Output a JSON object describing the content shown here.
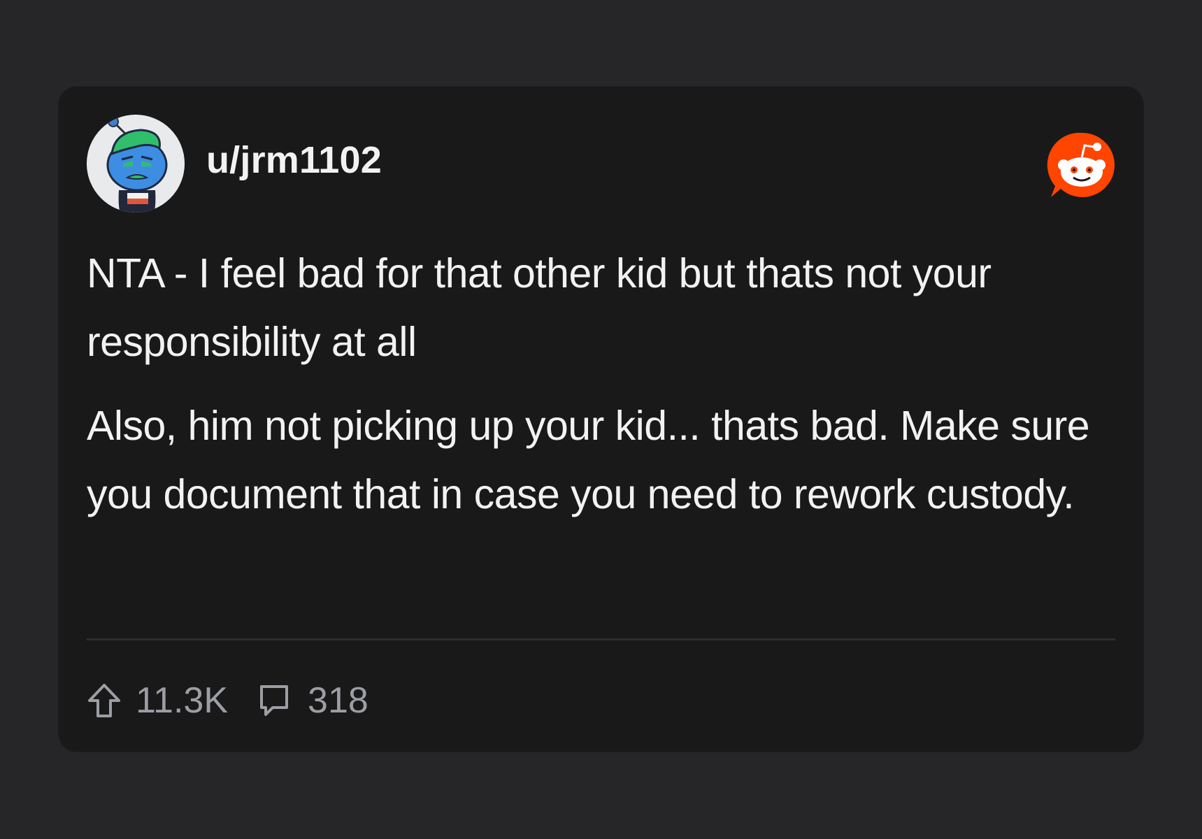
{
  "post": {
    "username": "u/jrm1102",
    "paragraphs": [
      "NTA - I feel bad for that other kid but thats not your responsibility at all",
      "Also, him not picking up your kid... thats bad. Make sure you document that in case you need to rework custody."
    ],
    "upvotes": "11.3K",
    "comments": "318"
  },
  "icons": {
    "avatar": "snoo-avatar",
    "brand_logo": "reddit-logo-icon",
    "upvote": "upvote-arrow-icon",
    "comment": "comment-bubble-icon"
  },
  "colors": {
    "page_background": "#262628",
    "card_background": "#19191a",
    "text": "#f2f2f2",
    "muted_text": "#9c9ea3",
    "reddit_orange": "#ff4500",
    "divider": "#2d2e31"
  }
}
